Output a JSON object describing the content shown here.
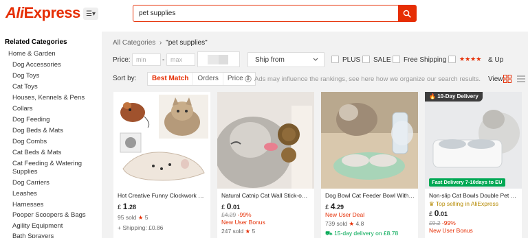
{
  "header": {
    "logo": "AliExpress",
    "search_value": "pet supplies",
    "menu_glyph": "☰▾"
  },
  "sidebar": {
    "title": "Related Categories",
    "parent": "Home & Garden",
    "items": [
      "Dog Accessories",
      "Dog Toys",
      "Cat Toys",
      "Houses, Kennels & Pens",
      "Collars",
      "Dog Feeding",
      "Dog Beds & Mats",
      "Dog Combs",
      "Cat Beds & Mats",
      "Cat Feeding & Watering",
      "Supplies",
      "Dog Carriers",
      "Leashes",
      "Harnesses",
      "Pooper Scoopers & Bags",
      "Agility Equipment",
      "Bath Sprayers"
    ]
  },
  "breadcrumb": {
    "root": "All Categories",
    "sep": "›",
    "query": "\"pet supplies\""
  },
  "filters": {
    "price_label": "Price:",
    "min_placeholder": "min",
    "dash": "-",
    "max_placeholder": "max",
    "ship_from": "Ship from",
    "plus": "PLUS",
    "sale": "SALE",
    "free_shipping": "Free Shipping",
    "stars": "★★★★",
    "and_up": "& Up"
  },
  "sort": {
    "label": "Sort by:",
    "options": [
      "Best Match",
      "Orders",
      "Price ⇕"
    ],
    "info": "Ads may influence the rankings, see here how we organize our search results.",
    "view_label": "View:"
  },
  "products": [
    {
      "title": "Hot Creative Funny Clockwork Spri...",
      "currency": "£",
      "price_int": "1",
      "price_dec": ".28",
      "line1": "95 sold",
      "rating": "5",
      "line2": "+ Shipping: £0.86"
    },
    {
      "title": "Natural Catnip Cat Wall Stick-on B...",
      "currency": "£",
      "price_int": "0",
      "price_dec": ".01",
      "orig_price": "£4.29",
      "discount": "-99%",
      "deal": "New User Bonus",
      "line1": "247 sold",
      "rating": "5"
    },
    {
      "title": "Dog Bowl Cat Feeder Bowl With D...",
      "currency": "£",
      "price_int": "4",
      "price_dec": ".29",
      "deal": "New User Deal",
      "line1": "739 sold",
      "rating": "4.8",
      "delivery": "15-day delivery on £8.78"
    },
    {
      "title": "Non-slip Cat Bowls Double Pet Bo...",
      "currency": "£",
      "price_int": "0",
      "price_dec": ".01",
      "orig_price": "£9.2",
      "discount": "-99%",
      "deal": "New User Bonus",
      "top_selling": "Top selling in AliExpress",
      "badge": "10-Day Delivery",
      "fast_delivery": "Fast Delivery 7-10days to EU"
    }
  ],
  "colors": {
    "brand": "#e62e04",
    "green": "#00a854"
  }
}
